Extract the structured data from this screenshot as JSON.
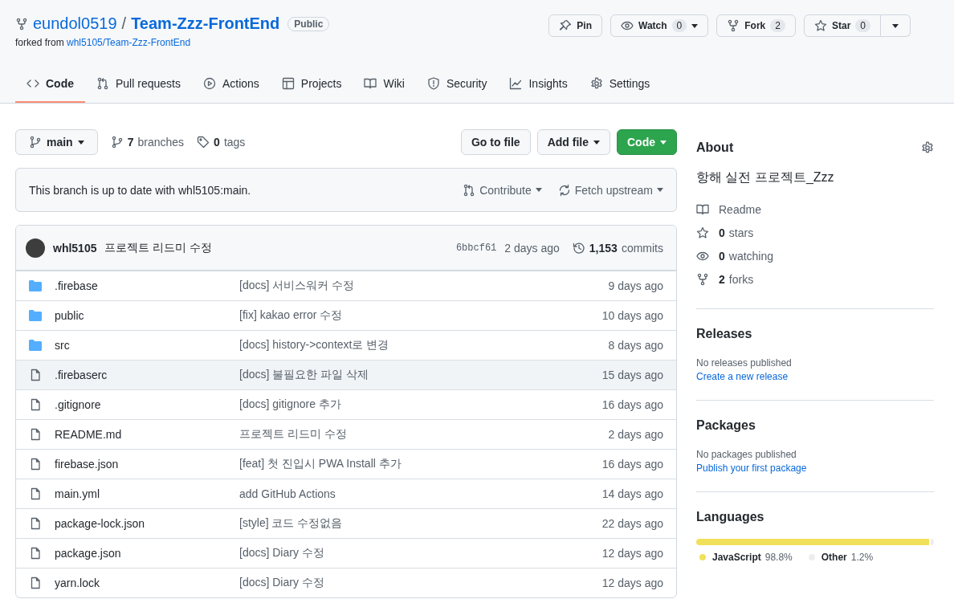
{
  "repo": {
    "owner": "eundol0519",
    "separator": "/",
    "name": "Team-Zzz-FrontEnd",
    "visibility": "Public",
    "forked_prefix": "forked from",
    "forked_from": "whl5105/Team-Zzz-FrontEnd"
  },
  "actions": [
    {
      "label": "Pin"
    },
    {
      "label": "Watch",
      "count": "0",
      "dropdown": true
    },
    {
      "label": "Fork",
      "count": "2"
    },
    {
      "label": "Star",
      "count": "0",
      "split": true
    }
  ],
  "tabs": [
    {
      "label": "Code",
      "selected": true
    },
    {
      "label": "Pull requests",
      "selected": false
    },
    {
      "label": "Actions",
      "selected": false
    },
    {
      "label": "Projects",
      "selected": false
    },
    {
      "label": "Wiki",
      "selected": false
    },
    {
      "label": "Security",
      "selected": false
    },
    {
      "label": "Insights",
      "selected": false
    },
    {
      "label": "Settings",
      "selected": false
    }
  ],
  "branch": {
    "name": "main",
    "branches_count": "7",
    "branches_label": "branches",
    "tags_count": "0",
    "tags_label": "tags"
  },
  "buttons": {
    "go_to_file": "Go to file",
    "add_file": "Add file",
    "code": "Code"
  },
  "banner": {
    "text": "This branch is up to date with whl5105:main.",
    "contribute": "Contribute",
    "fetch": "Fetch upstream"
  },
  "commit": {
    "author": "whl5105",
    "message": "프로젝트 리드미 수정",
    "sha": "6bbcf61",
    "time": "2 days ago",
    "count": "1,153",
    "count_label": "commits"
  },
  "files": [
    {
      "kind": "folder",
      "name": ".firebase",
      "message": "[docs] 서비스워커 수정",
      "time": "9 days ago",
      "selected": false
    },
    {
      "kind": "folder",
      "name": "public",
      "message": "[fix] kakao error 수정",
      "time": "10 days ago",
      "selected": false
    },
    {
      "kind": "folder",
      "name": "src",
      "message": "[docs] history->context로 변경",
      "time": "8 days ago",
      "selected": false
    },
    {
      "kind": "file",
      "name": ".firebaserc",
      "message": "[docs] 불필요한 파일 삭제",
      "time": "15 days ago",
      "selected": true
    },
    {
      "kind": "file",
      "name": ".gitignore",
      "message": "[docs] gitignore 추가",
      "time": "16 days ago",
      "selected": false
    },
    {
      "kind": "file",
      "name": "README.md",
      "message": "프로젝트 리드미 수정",
      "time": "2 days ago",
      "selected": false
    },
    {
      "kind": "file",
      "name": "firebase.json",
      "message": "[feat] 첫 진입시 PWA Install 추가",
      "time": "16 days ago",
      "selected": false
    },
    {
      "kind": "file",
      "name": "main.yml",
      "message": "add GitHub Actions",
      "time": "14 days ago",
      "selected": false
    },
    {
      "kind": "file",
      "name": "package-lock.json",
      "message": "[style] 코드 수정없음",
      "time": "22 days ago",
      "selected": false
    },
    {
      "kind": "file",
      "name": "package.json",
      "message": "[docs] Diary 수정",
      "time": "12 days ago",
      "selected": false
    },
    {
      "kind": "file",
      "name": "yarn.lock",
      "message": "[docs] Diary 수정",
      "time": "12 days ago",
      "selected": false
    }
  ],
  "about": {
    "title": "About",
    "description": "항해 실전 프로젝트_Zzz",
    "stats": [
      {
        "kind": "readme",
        "label": "Readme"
      },
      {
        "kind": "stars",
        "count": "0",
        "label": "stars"
      },
      {
        "kind": "watching",
        "count": "0",
        "label": "watching"
      },
      {
        "kind": "forks",
        "count": "2",
        "label": "forks"
      }
    ]
  },
  "releases": {
    "title": "Releases",
    "note": "No releases published",
    "link": "Create a new release"
  },
  "packages": {
    "title": "Packages",
    "note": "No packages published",
    "link": "Publish your first package"
  },
  "languages": {
    "title": "Languages",
    "items": [
      {
        "name": "JavaScript",
        "percent": "98.8%",
        "level": 0.988,
        "color": "#f1e05a"
      },
      {
        "name": "Other",
        "percent": "1.2%",
        "level": 0.012,
        "color": "#ededed"
      }
    ]
  }
}
